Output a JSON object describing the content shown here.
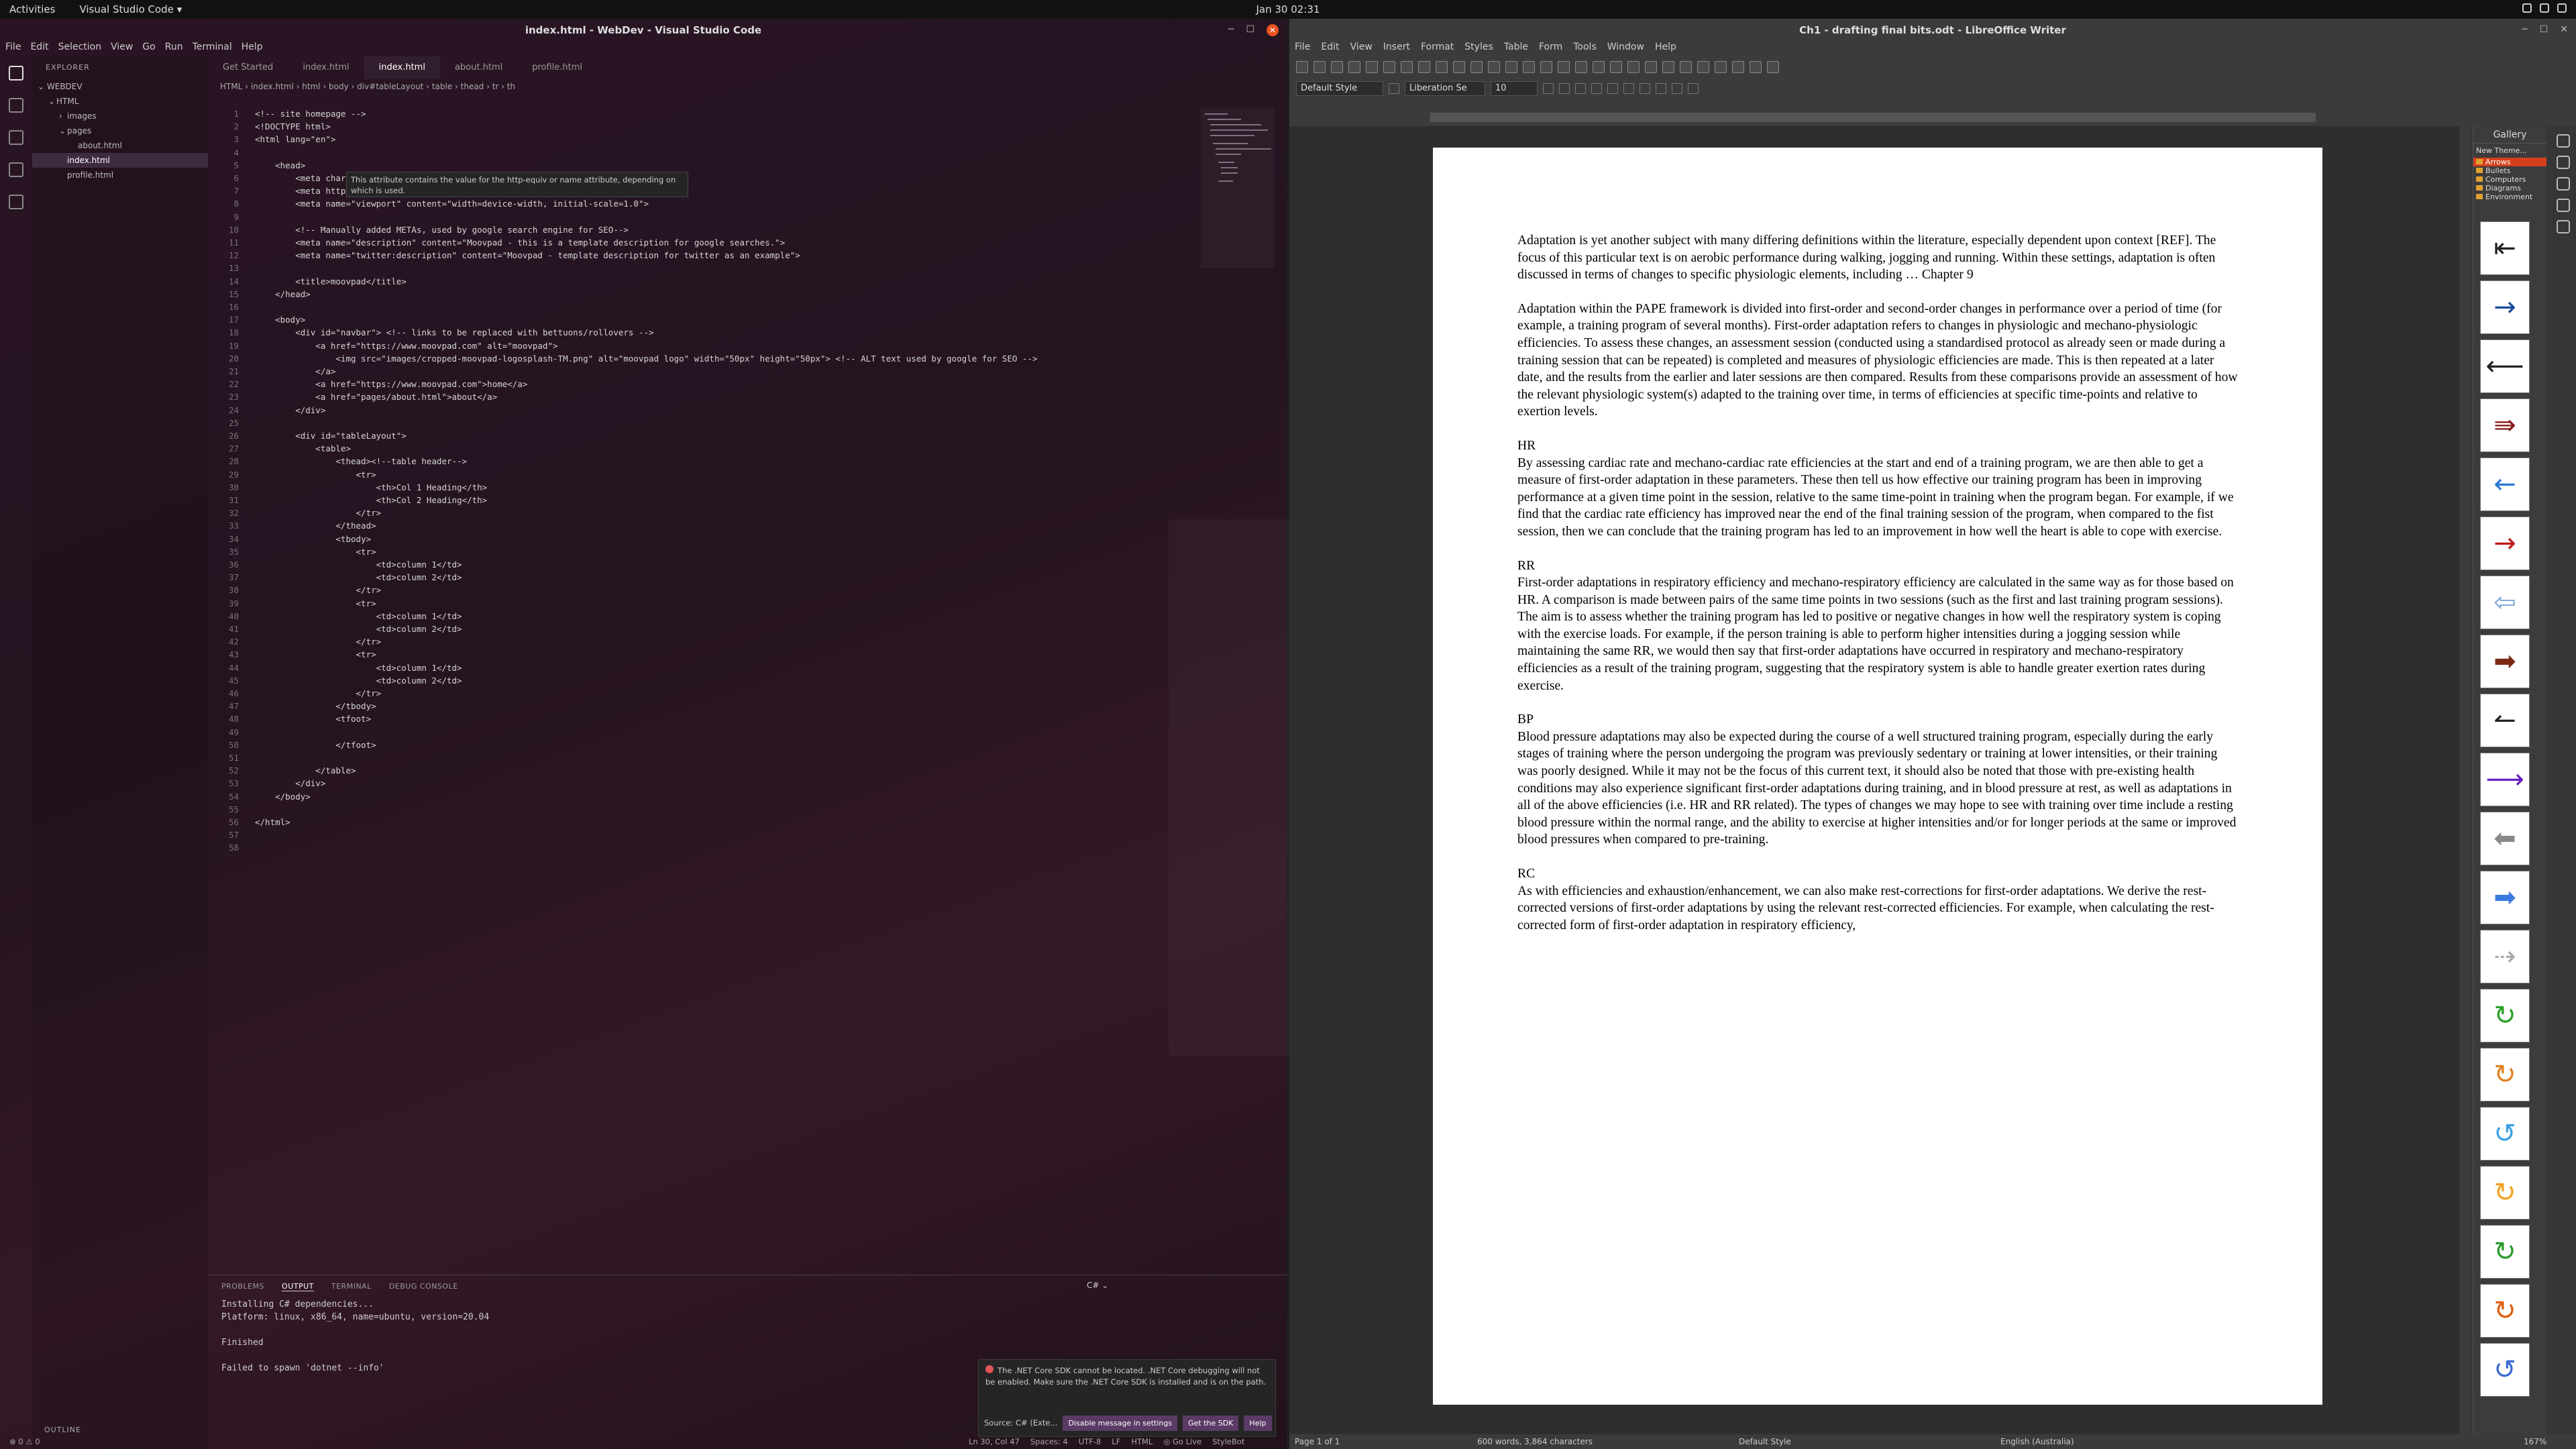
{
  "topbar": {
    "activities": "Activities",
    "app": "Visual Studio Code ▾",
    "clock": "Jan 30  02:31"
  },
  "vscode": {
    "title": "index.html - WebDev - Visual Studio Code",
    "menu": [
      "File",
      "Edit",
      "Selection",
      "View",
      "Go",
      "Run",
      "Terminal",
      "Help"
    ],
    "explorer": {
      "header": "EXPLORER",
      "project": "WEBDEV",
      "items": [
        {
          "label": "HTML",
          "depth": 1,
          "caret": "⌄"
        },
        {
          "label": "images",
          "depth": 2,
          "caret": "›"
        },
        {
          "label": "pages",
          "depth": 2,
          "caret": "⌄"
        },
        {
          "label": "about.html",
          "depth": 3,
          "caret": ""
        },
        {
          "label": "index.html",
          "depth": 2,
          "caret": "",
          "selected": true
        },
        {
          "label": "profile.html",
          "depth": 2,
          "caret": ""
        }
      ],
      "outline": "OUTLINE"
    },
    "tabs": [
      "Get Started",
      "index.html",
      "index.html",
      "about.html",
      "profile.html"
    ],
    "active_tab": 2,
    "breadcrumb": "HTML › index.html › html › body › div#tableLayout › table › thead › tr › th",
    "code": [
      "<!-- site homepage -->",
      "<!DOCTYPE html>",
      "<html lang=\"en\">",
      "",
      "    <head>",
      "        <meta charset=\"UTF-8\">",
      "        <meta http-equiv=\"X-UA",
      "        <meta name=\"viewport\" content=\"width=device-width, initial-scale=1.0\">",
      "",
      "        <!-- Manually added METAs, used by google search engine for SEO-->",
      "        <meta name=\"description\" content=\"Moovpad - this is a template description for google searches.\">",
      "        <meta name=\"twitter:description\" content=\"Moovpad - template description for twitter as an example\">",
      "",
      "        <title>moovpad</title>",
      "    </head>",
      "",
      "    <body>",
      "        <div id=\"navbar\"> <!-- links to be replaced with bettuons/rollovers -->",
      "            <a href=\"https://www.moovpad.com\" alt=\"moovpad\">",
      "                <img src=\"images/cropped-moovpad-logosplash-TM.png\" alt=\"moovpad logo\" width=\"50px\" height=\"50px\"> <!-- ALT text used by google for SEO -->",
      "            </a>",
      "            <a href=\"https://www.moovpad.com\">home</a>",
      "            <a href=\"pages/about.html\">about</a>",
      "        </div>",
      "",
      "        <div id=\"tableLayout\">",
      "            <table>",
      "                <thead><!--table header-->",
      "                    <tr>",
      "                        <th>Col 1 Heading</th>",
      "                        <th>Col 2 Heading</th>",
      "                    </tr>",
      "                </thead>",
      "                <tbody>",
      "                    <tr>",
      "                        <td>column 1</td>",
      "                        <td>column 2</td>",
      "                    </tr>",
      "                    <tr>",
      "                        <td>column 1</td>",
      "                        <td>column 2</td>",
      "                    </tr>",
      "                    <tr>",
      "                        <td>column 1</td>",
      "                        <td>column 2</td>",
      "                    </tr>",
      "                </tbody>",
      "                <tfoot>",
      "",
      "                </tfoot>",
      "",
      "            </table>",
      "        </div>",
      "    </body>",
      "",
      "</html>",
      "",
      ""
    ],
    "tooltip": "This attribute contains the value for the http-equiv or name attribute, depending on which is used.",
    "panel": {
      "tabs": [
        "PROBLEMS",
        "OUTPUT",
        "TERMINAL",
        "DEBUG CONSOLE"
      ],
      "active": 1,
      "channel": "C#",
      "output": [
        "Installing C# dependencies...",
        "Platform: linux, x86_64, name=ubuntu, version=20.04",
        "",
        "Finished",
        "",
        "Failed to spawn 'dotnet --info'"
      ]
    },
    "notification": {
      "text": "The .NET Core SDK cannot be located. .NET Core debugging will not be enabled. Make sure the .NET Core SDK is installed and is on the path.",
      "source": "Source: C# (Exte...",
      "buttons": [
        "Disable message in settings",
        "Get the SDK",
        "Help"
      ]
    },
    "status": {
      "left": "⊗ 0 ⚠ 0",
      "items": [
        "Ln 30, Col 47",
        "Spaces: 4",
        "UTF-8",
        "LF",
        "HTML",
        "◎ Go Live",
        "StyleBot"
      ]
    }
  },
  "writer": {
    "title": "Ch1 - drafting final bits.odt - LibreOffice Writer",
    "menu": [
      "File",
      "Edit",
      "View",
      "Insert",
      "Format",
      "Styles",
      "Table",
      "Form",
      "Tools",
      "Window",
      "Help"
    ],
    "para_style": "Default Style",
    "font": "Liberation Se",
    "size": "10",
    "paragraphs": [
      {
        "h": "",
        "t": "Adaptation is yet another subject with many differing definitions within the literature, especially dependent upon context [REF]. The focus of this particular text is on aerobic performance during walking, jogging and running. Within these settings, adaptation is often discussed in terms of changes to specific physiologic elements, including … Chapter 9"
      },
      {
        "h": "",
        "t": "Adaptation within the PAPE framework is divided into first-order and second-order changes in performance over a period of time (for example, a training program of several months). First-order adaptation refers to changes in physiologic and mechano-physiologic efficiencies. To assess these changes, an assessment session (conducted using a standardised protocol as already seen or made during a training session that can be repeated) is completed and measures of physiologic efficiencies are made. This is then repeated at a later date, and the results from the earlier and later sessions are then compared. Results from these comparisons provide an assessment of how the relevant physiologic system(s) adapted to the training over time, in terms of efficiencies at specific time-points and relative to exertion levels."
      },
      {
        "h": "HR",
        "t": "By assessing cardiac rate and mechano-cardiac rate efficiencies at the start and end of a training program, we are then able to get a measure of first-order adaptation in these parameters. These then tell us how effective our training program has been in improving performance at a given time point in the session, relative to the same time-point in training when the program began. For example, if we find that the cardiac rate efficiency has improved near the end of the final training session of the program, when compared to the fist session, then we can conclude that the training program has led to an improvement in how well the heart is able to cope with exercise."
      },
      {
        "h": "RR",
        "t": "First-order adaptations in respiratory efficiency and mechano-respiratory efficiency are calculated in the same way as for those based on HR. A comparison is made between pairs of the same time points in two sessions (such as the first and last training program sessions). The aim is to assess whether the training program has led to positive or negative changes in how well the respiratory system is coping with the exercise loads. For example, if the person training is able to perform higher intensities during a jogging session while maintaining the same RR, we would then say that first-order adaptations have occurred in respiratory and mechano-respiratory efficiencies as a result of the training program, suggesting that the respiratory system is able to handle greater exertion rates during exercise."
      },
      {
        "h": "BP",
        "t": "Blood pressure adaptations may also be expected during the course of a well structured training program, especially during the early stages of training where the person undergoing the program was previously sedentary or training at lower intensities, or their training was poorly designed. While it may not be the focus of this current text, it should also be noted that those with pre-existing health conditions may also experience significant first-order adaptations during training, and in blood pressure at rest, as well as adaptations in all of the above efficiencies (i.e. HR and RR related). The types of changes we may hope to see with training over time include a resting blood pressure within the normal range, and the ability to exercise at higher intensities and/or for longer periods at the same or improved blood pressures when compared to pre-training."
      },
      {
        "h": "RC",
        "t": "As with efficiencies and exhaustion/enhancement, we can also make rest-corrections for first-order adaptations. We derive the rest-corrected versions of first-order adaptations by using the relevant rest-corrected efficiencies. For example, when calculating the rest-corrected form of first-order adaptation in respiratory efficiency,"
      }
    ],
    "gallery": {
      "title": "Gallery",
      "new_theme": "New Theme...",
      "themes": [
        "Arrows",
        "Bullets",
        "Computers",
        "Diagrams",
        "Environment"
      ],
      "selected": 0,
      "cells": [
        "⇤",
        "→",
        "⟵",
        "⇛",
        "←",
        "→",
        "⇦",
        "➡",
        "↼",
        "⟶",
        "⬅",
        "➡",
        "⇢",
        "↻",
        "↻",
        "↺",
        "↻",
        "↻",
        "↻",
        "↺"
      ]
    },
    "status": {
      "page": "Page 1 of 1",
      "words": "600 words, 3,864 characters",
      "style": "Default Style",
      "lang": "English (Australia)",
      "zoom": "167%"
    }
  }
}
